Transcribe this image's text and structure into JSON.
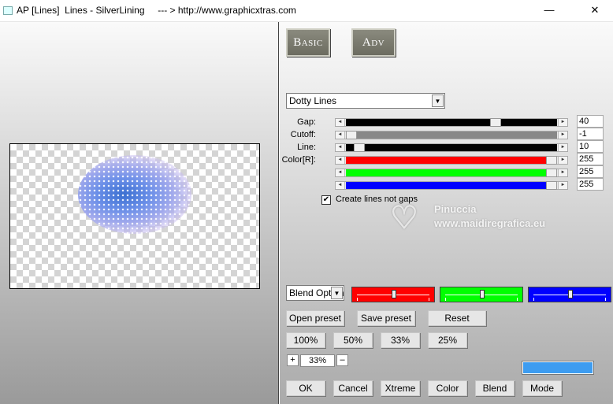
{
  "window": {
    "title": "AP [Lines]  Lines - SilverLining     --- > http://www.graphicxtras.com",
    "min_glyph": "—",
    "close_glyph": "✕"
  },
  "mode_buttons": {
    "basic": "Basic",
    "adv": "Adv"
  },
  "effect_select": {
    "value": "Dotty Lines",
    "arrow": "▼"
  },
  "sliders": [
    {
      "label": "Gap:",
      "value": "40",
      "level": 0.72,
      "fill": "#000000"
    },
    {
      "label": "Cutoff:",
      "value": "-1",
      "level": 0.0,
      "fill": "#888888"
    },
    {
      "label": "Line:",
      "value": "10",
      "level": 0.04,
      "fill": "#000000"
    },
    {
      "label": "Color[R]:",
      "value": "255",
      "level": 1.0,
      "fill": "#ff0000"
    },
    {
      "label": "",
      "value": "255",
      "level": 1.0,
      "fill": "#00ff00"
    },
    {
      "label": "",
      "value": "255",
      "level": 1.0,
      "fill": "#0000ff"
    }
  ],
  "slider_arrows": {
    "left": "◄",
    "right": "►"
  },
  "checkbox": {
    "label": "Create lines not gaps",
    "checked": true,
    "mark": "✔"
  },
  "watermark": {
    "name": "Pinuccia",
    "url": "www.maidiregrafica.eu",
    "heart": "♡"
  },
  "blend": {
    "select_value": "Blend Options",
    "arrow": "▼"
  },
  "color_swatches": [
    {
      "color": "#ff0000",
      "level": 0.5
    },
    {
      "color": "#00ff00",
      "level": 0.5
    },
    {
      "color": "#0000ff",
      "level": 0.5
    }
  ],
  "buttons": {
    "open_preset": "Open preset",
    "save_preset": "Save preset",
    "reset": "Reset",
    "z100": "100%",
    "z50": "50%",
    "z33": "33%",
    "z25": "25%",
    "ok": "OK",
    "cancel": "Cancel",
    "xtreme": "Xtreme",
    "color": "Color",
    "blend": "Blend",
    "mode": "Mode"
  },
  "zoom": {
    "plus": "+",
    "value": "33%",
    "minus": "–"
  },
  "color_preview": "#3d9cf0"
}
